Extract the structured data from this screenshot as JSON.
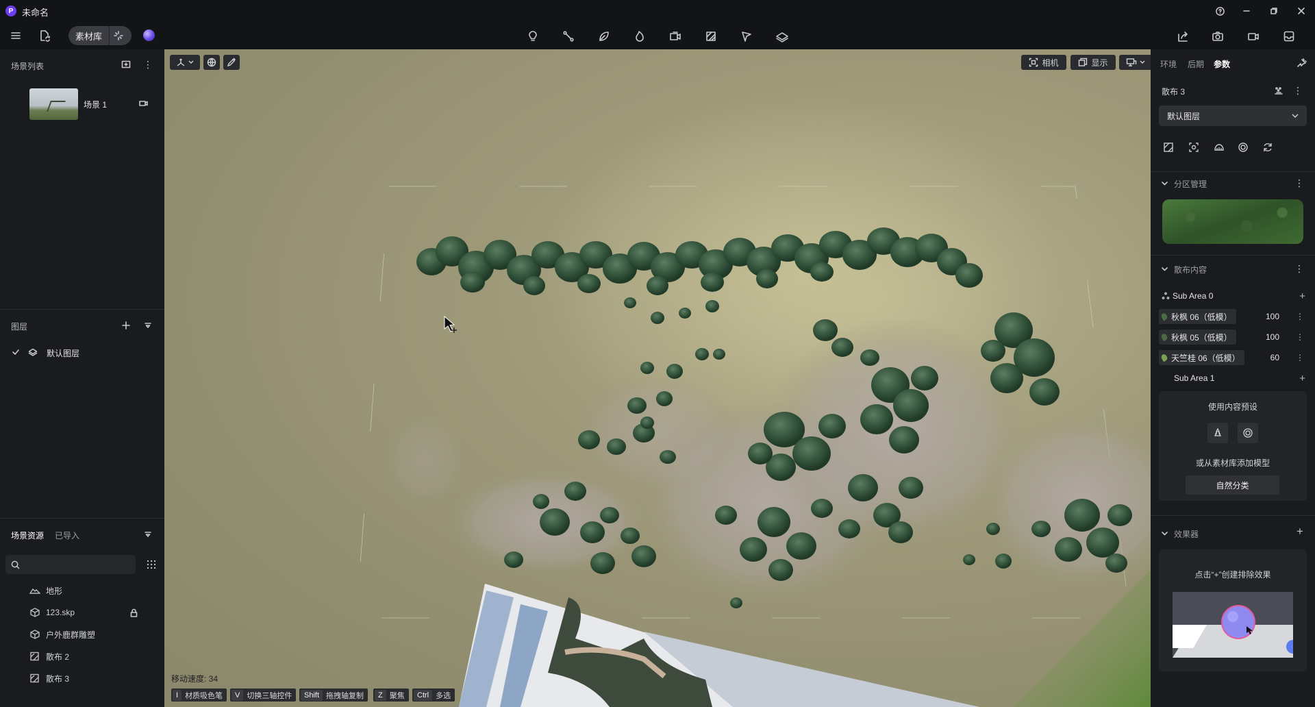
{
  "window": {
    "logo_letter": "P",
    "title": "未命名",
    "help_icon": "help-icon",
    "minimize_icon": "minimize-icon",
    "restore_icon": "restore-icon",
    "close_icon": "close-icon"
  },
  "toolbar": {
    "menu_icon": "hamburger-menu-icon",
    "file_icon": "file-sync-icon",
    "asset_library_label": "素材库",
    "ai_tools": [
      "light-bulb-icon",
      "path-icon",
      "leaf-icon",
      "flame-icon",
      "video-export-icon",
      "pattern-icon",
      "flag-pin-icon",
      "layers-icon"
    ],
    "right_tools": [
      "share-icon",
      "camera-icon",
      "video-camera-icon",
      "inbox-icon"
    ]
  },
  "left": {
    "scene_list_title": "场景列表",
    "scenes": [
      {
        "name": "场景 1"
      }
    ],
    "layers_title": "图层",
    "layers": [
      {
        "name": "默认图层",
        "checked": true
      }
    ],
    "assets_tab_active": "场景资源",
    "assets_tab_inactive": "已导入",
    "search_placeholder": "",
    "assets": [
      {
        "name": "地形",
        "icon": "terrain-icon"
      },
      {
        "name": "123.skp",
        "icon": "model-icon",
        "locked": true
      },
      {
        "name": "户外鹿群雕塑",
        "icon": "model-icon"
      },
      {
        "name": "散布 2",
        "icon": "scatter-icon"
      },
      {
        "name": "散布 3",
        "icon": "scatter-icon"
      }
    ]
  },
  "viewport": {
    "camera_label": "相机",
    "display_label": "显示",
    "move_speed": "移动速度: 34",
    "shortcuts": [
      {
        "key": "I",
        "label": "材质吸色笔"
      },
      {
        "key": "V",
        "label": "切换三轴控件"
      },
      {
        "key": "Shift",
        "label": "拖拽轴复制"
      },
      {
        "key": "Z",
        "label": "聚焦"
      },
      {
        "key": "Ctrl",
        "label": "多选"
      }
    ]
  },
  "right": {
    "tabs": [
      "环境",
      "后期",
      "参数"
    ],
    "active_tab": "参数",
    "object_name": "散布 3",
    "layer_select": "默认图层",
    "zone_section": "分区管理",
    "content_section": "散布内容",
    "sub_area_0": "Sub Area 0",
    "plants": [
      {
        "name": "秋枫 06（低模）",
        "count": "100"
      },
      {
        "name": "秋枫 05（低模）",
        "count": "100"
      },
      {
        "name": "天竺桂 06（低模）",
        "count": "60"
      }
    ],
    "sub_area_1": "Sub Area 1",
    "use_preset": "使用内容预设",
    "or_add": "或从素材库添加模型",
    "natural_category": "自然分类",
    "effector_section": "效果器",
    "effector_hint": "点击“+”创建排除效果"
  }
}
